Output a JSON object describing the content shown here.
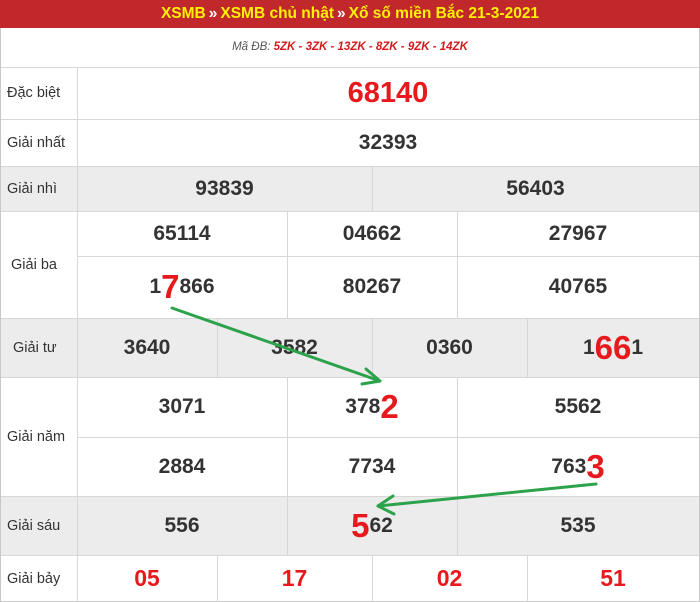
{
  "header": {
    "crumb1": "XSMB",
    "sep": "»",
    "crumb2": "XSMB chủ nhật",
    "crumb3": "Xổ số miền Bắc 21-3-2021"
  },
  "code_line": {
    "prefix": "Mã ĐB: ",
    "codes": "5ZK - 3ZK - 13ZK - 8ZK - 9ZK - 14ZK"
  },
  "prizes": {
    "special": {
      "label": "Đặc biệt",
      "number": "68140"
    },
    "first": {
      "label": "Giải nhất",
      "number": "32393"
    },
    "second": {
      "label": "Giải nhì",
      "numbers": [
        "93839",
        "56403"
      ]
    },
    "third": {
      "label": "Giải ba",
      "row1": [
        "65114",
        "04662",
        "27967"
      ],
      "row2": [
        {
          "a": "1",
          "hl": "7",
          "b": "866"
        },
        {
          "a": "80267",
          "hl": "",
          "b": ""
        },
        {
          "a": "40765",
          "hl": "",
          "b": ""
        }
      ]
    },
    "fourth": {
      "label": "Giải tư",
      "numbers": [
        {
          "a": "3640",
          "hl": "",
          "b": ""
        },
        {
          "a": "3582",
          "hl": "",
          "b": ""
        },
        {
          "a": "0360",
          "hl": "",
          "b": ""
        },
        {
          "a": "1",
          "hl": "66",
          "b": "1"
        }
      ]
    },
    "fifth": {
      "label": "Giải năm",
      "row1": [
        {
          "a": "3071",
          "hl": "",
          "b": ""
        },
        {
          "a": "378",
          "hl": "2",
          "b": ""
        },
        {
          "a": "5562",
          "hl": "",
          "b": ""
        }
      ],
      "row2": [
        {
          "a": "2884",
          "hl": "",
          "b": ""
        },
        {
          "a": "7734",
          "hl": "",
          "b": ""
        },
        {
          "a": "763",
          "hl": "3",
          "b": ""
        }
      ]
    },
    "sixth": {
      "label": "Giải sáu",
      "numbers": [
        {
          "a": "556",
          "hl": "",
          "b": ""
        },
        {
          "a": "",
          "hl": "5",
          "b": "62"
        },
        {
          "a": "535",
          "hl": "",
          "b": ""
        }
      ]
    },
    "seventh": {
      "label": "Giải bảy",
      "numbers": [
        "05",
        "17",
        "02",
        "51"
      ]
    }
  },
  "colors": {
    "header_bg": "#c0282b",
    "header_text": "#fff200",
    "highlight_red": "#e8191c",
    "arrow_green": "#2ca24a",
    "band_gray": "#ececec"
  }
}
